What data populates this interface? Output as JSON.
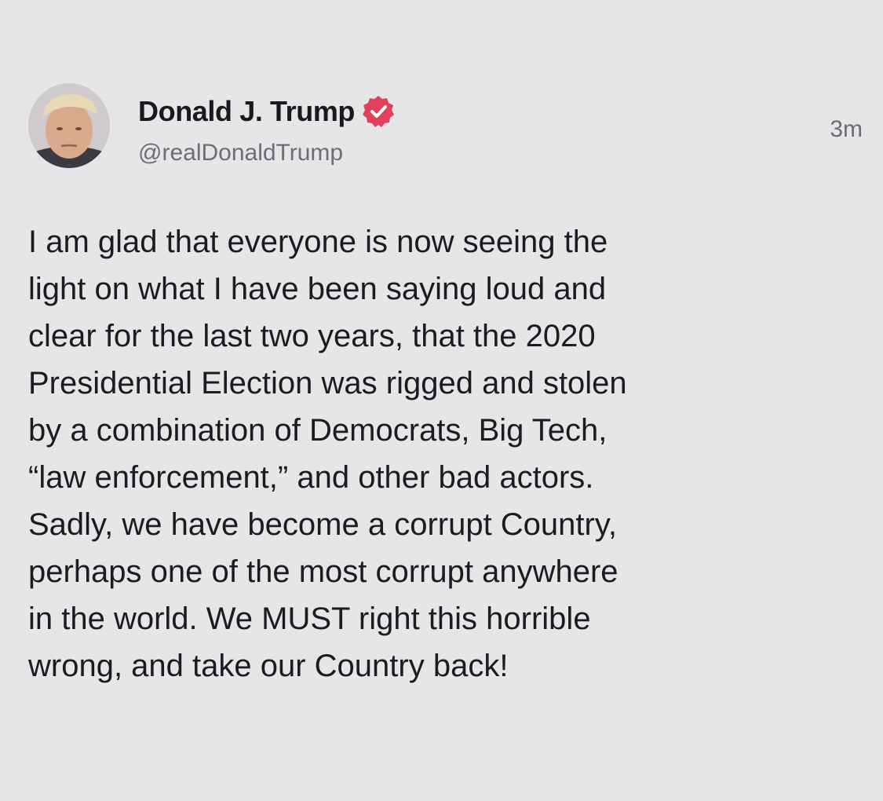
{
  "author": {
    "display_name": "Donald J. Trump",
    "handle": "@realDonaldTrump",
    "avatar_icon": "profile-photo",
    "verified_icon": "verified-badge-icon",
    "verified_color": "#e2405a"
  },
  "post": {
    "timestamp": "3m",
    "lines": [
      "I am glad that everyone is now seeing the",
      "light on what I have been saying loud and",
      "clear for the last two years, that the 2020",
      "Presidential Election was rigged and stolen",
      "by a combination of Democrats, Big Tech,",
      "“law enforcement,” and other bad actors.",
      "Sadly, we have become a corrupt Country,",
      "perhaps one of the most corrupt anywhere",
      "in the world. We MUST right this horrible",
      "wrong, and take our Country back!"
    ]
  }
}
